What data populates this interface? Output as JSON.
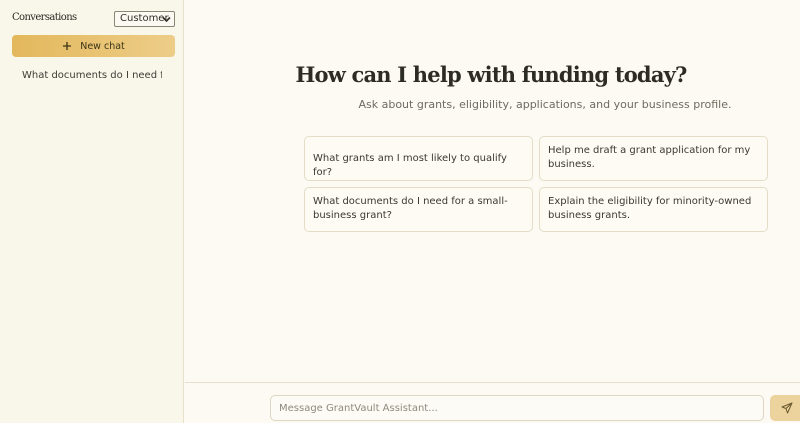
{
  "sidebar": {
    "title": "Conversations",
    "role_select": {
      "selected": "Customer"
    },
    "new_chat_label": "New chat",
    "history": [
      {
        "label": "What documents do I need f"
      }
    ]
  },
  "main": {
    "title": "How can I help with funding today?",
    "subtitle": "Ask about grants, eligibility, applications, and your business profile.",
    "suggestions": [
      {
        "text": "What grants am I most likely to qualify for?"
      },
      {
        "text": "Help me draft a grant application for my business."
      },
      {
        "text": "What documents do I need for a small-business grant?"
      },
      {
        "text": "Explain the eligibility for minority-owned business grants."
      }
    ]
  },
  "composer": {
    "placeholder": "Message GrantVault Assistant...",
    "value": ""
  },
  "icons": {
    "new_chat": "plus-icon",
    "select": "chevron-down-icon",
    "send": "send-icon"
  },
  "colors": {
    "accent": "#e3b85c",
    "accent_light": "#edcd88",
    "send_bg": "#ecd39e",
    "background": "#fcfaf3",
    "sidebar_bg": "#f9f6ea"
  }
}
